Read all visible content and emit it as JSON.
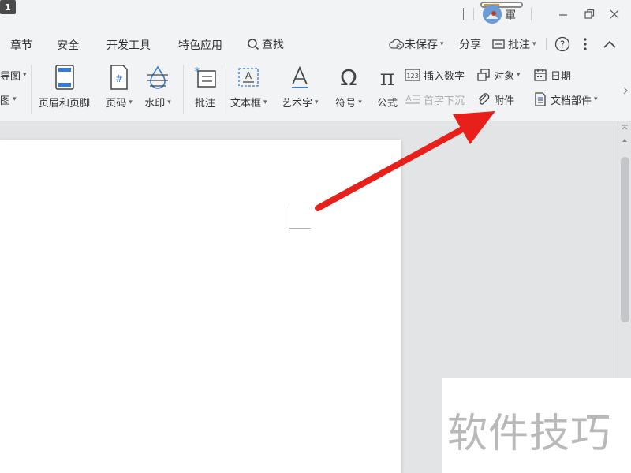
{
  "titlebar": {
    "window_count": "1",
    "username": "軍"
  },
  "menu": {
    "tabs": [
      "章节",
      "安全",
      "开发工具",
      "特色应用"
    ],
    "search_label": "查找",
    "save_status": "未保存",
    "share_label": "分享",
    "comment_label": "批注"
  },
  "ribbon": {
    "partial_top": "导图",
    "partial_bottom": "图",
    "header_footer": "页眉和页脚",
    "page_number": "页码",
    "watermark": "水印",
    "comment": "批注",
    "textbox": "文本框",
    "wordart": "艺术字",
    "symbol": "符号",
    "formula": "公式",
    "insert_number": "插入数字",
    "object": "对象",
    "date": "日期",
    "drop_cap": "首字下沉",
    "attachment": "附件",
    "doc_parts": "文档部件"
  },
  "watermark_text": "软件技巧",
  "colors": {
    "ribbon_bg": "#f2f3f5",
    "workspace_bg": "#e3e4e6",
    "arrow": "#e8201c",
    "icon_blue": "#3a7bd5"
  }
}
